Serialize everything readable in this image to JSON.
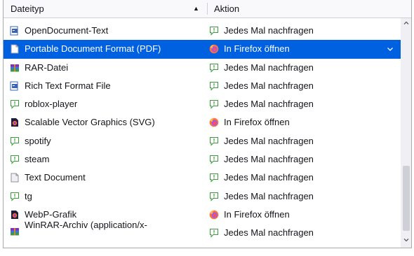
{
  "header": {
    "type_label": "Dateityp",
    "action_label": "Aktion"
  },
  "rows": [
    {
      "type": "OpenDocument-Text",
      "type_icon": "document-icon",
      "action": "Jedes Mal nachfragen",
      "action_icon": "ask-icon"
    },
    {
      "type": "Portable Document Format (PDF)",
      "type_icon": "pdf-file-icon",
      "action": "In Firefox öffnen",
      "action_icon": "firefox-icon",
      "selected": true
    },
    {
      "type": "RAR-Datei",
      "type_icon": "archive-icon",
      "action": "Jedes Mal nachfragen",
      "action_icon": "ask-icon"
    },
    {
      "type": "Rich Text Format File",
      "type_icon": "document-icon",
      "action": "Jedes Mal nachfragen",
      "action_icon": "ask-icon"
    },
    {
      "type": "roblox-player",
      "type_icon": "ask-icon",
      "action": "Jedes Mal nachfragen",
      "action_icon": "ask-icon"
    },
    {
      "type": "Scalable Vector Graphics (SVG)",
      "type_icon": "firefox-file-icon",
      "action": "In Firefox öffnen",
      "action_icon": "firefox-icon"
    },
    {
      "type": "spotify",
      "type_icon": "ask-icon",
      "action": "Jedes Mal nachfragen",
      "action_icon": "ask-icon"
    },
    {
      "type": "steam",
      "type_icon": "ask-icon",
      "action": "Jedes Mal nachfragen",
      "action_icon": "ask-icon"
    },
    {
      "type": "Text Document",
      "type_icon": "text-file-icon",
      "action": "Jedes Mal nachfragen",
      "action_icon": "ask-icon"
    },
    {
      "type": "tg",
      "type_icon": "ask-icon",
      "action": "Jedes Mal nachfragen",
      "action_icon": "ask-icon"
    },
    {
      "type": "WebP-Grafik",
      "type_icon": "firefox-file-icon",
      "action": "In Firefox öffnen",
      "action_icon": "firefox-icon"
    },
    {
      "type": "WinRAR-Archiv (application/x-",
      "type_icon": "archive-icon",
      "action": "Jedes Mal nachfragen",
      "action_icon": "ask-icon"
    }
  ],
  "colors": {
    "selection": "#0061e0",
    "header_bg": "#f9f9fb",
    "scrollbar_track": "#f0f0f4",
    "scrollbar_thumb": "#cfcfd8"
  }
}
